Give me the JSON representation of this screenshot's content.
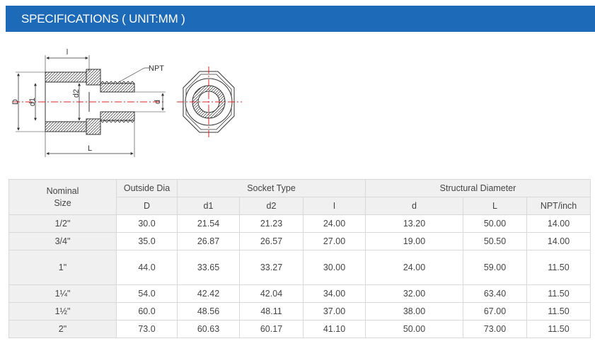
{
  "header": {
    "title": "SPECIFICATIONS ( UNIT:MM )"
  },
  "diagram": {
    "labels": {
      "npt": "NPT",
      "D": "D",
      "d1": "d1",
      "d2": "d2",
      "d": "d",
      "l": "l",
      "L": "L"
    }
  },
  "table": {
    "group_headers": {
      "nominal_line1": "Nominal",
      "nominal_line2": "Size",
      "outside_dia": "Outside Dia",
      "socket_type": "Socket Type",
      "structural_diameter": "Structural Diameter"
    },
    "sub_headers": [
      "D",
      "d1",
      "d2",
      "I",
      "d",
      "L",
      "NPT/inch"
    ],
    "rows": [
      {
        "size": "1/2\"",
        "cells": [
          "30.0",
          "21.54",
          "21.23",
          "24.00",
          "13.20",
          "50.00",
          "14.00"
        ]
      },
      {
        "size": "3/4\"",
        "cells": [
          "35.0",
          "26.87",
          "26.57",
          "27.00",
          "19.00",
          "50.50",
          "14.00"
        ]
      },
      {
        "size": "1\"",
        "cells": [
          "44.0",
          "33.65",
          "33.27",
          "30.00",
          "24.00",
          "59.00",
          "11.50"
        ]
      },
      {
        "size": "1¼\"",
        "cells": [
          "54.0",
          "42.42",
          "42.04",
          "34.00",
          "32.00",
          "63.40",
          "11.50"
        ]
      },
      {
        "size": "1½\"",
        "cells": [
          "60.0",
          "48.56",
          "48.11",
          "37.00",
          "38.00",
          "67.00",
          "11.50"
        ]
      },
      {
        "size": "2\"",
        "cells": [
          "73.0",
          "60.63",
          "60.17",
          "41.10",
          "50.00",
          "73.00",
          "11.50"
        ]
      }
    ]
  }
}
